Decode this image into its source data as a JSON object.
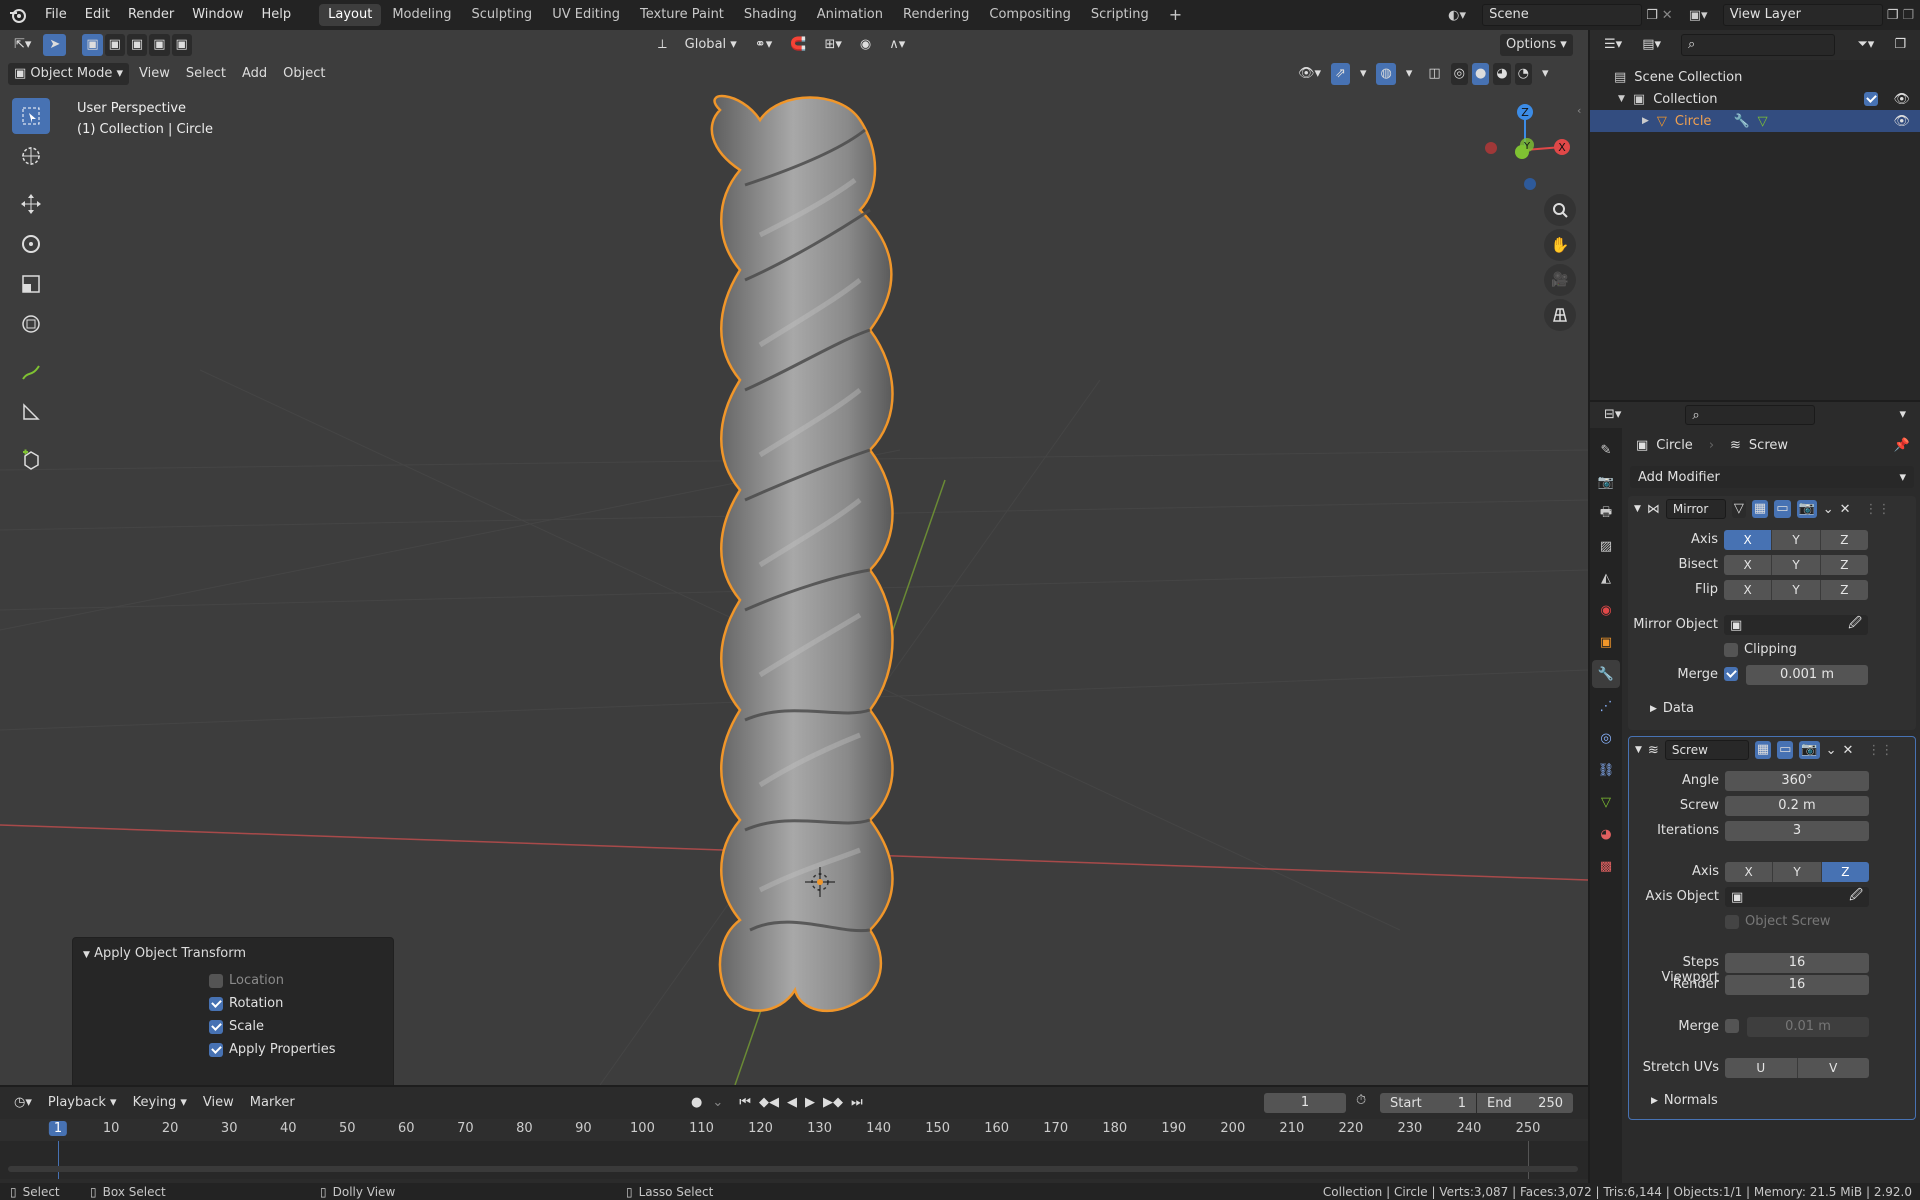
{
  "topbar": {
    "menus": [
      "File",
      "Edit",
      "Render",
      "Window",
      "Help"
    ],
    "workspaces": [
      "Layout",
      "Modeling",
      "Sculpting",
      "UV Editing",
      "Texture Paint",
      "Shading",
      "Animation",
      "Rendering",
      "Compositing",
      "Scripting"
    ],
    "active_workspace": "Layout",
    "scene": "Scene",
    "view_layer": "View Layer"
  },
  "viewport": {
    "transform_orientation": "Global",
    "options_label": "Options",
    "mode": "Object Mode",
    "header_menus": [
      "View",
      "Select",
      "Add",
      "Object"
    ],
    "overlay_line1": "User Perspective",
    "overlay_line2": "(1) Collection | Circle",
    "gizmo": {
      "x": "X",
      "y": "Y",
      "z": "Z"
    }
  },
  "redo_panel": {
    "title": "Apply Object Transform",
    "options": [
      {
        "label": "Location",
        "checked": false
      },
      {
        "label": "Rotation",
        "checked": true
      },
      {
        "label": "Scale",
        "checked": true
      },
      {
        "label": "Apply Properties",
        "checked": true
      }
    ]
  },
  "timeline": {
    "menus": [
      "Playback",
      "Keying",
      "View",
      "Marker"
    ],
    "current_frame": "1",
    "start_label": "Start",
    "start": "1",
    "end_label": "End",
    "end": "250",
    "ticks": [
      "1",
      "10",
      "20",
      "30",
      "40",
      "50",
      "60",
      "70",
      "80",
      "90",
      "100",
      "110",
      "120",
      "130",
      "140",
      "150",
      "160",
      "170",
      "180",
      "190",
      "200",
      "210",
      "220",
      "230",
      "240",
      "250"
    ]
  },
  "statusbar": {
    "select": "Select",
    "box_select": "Box Select",
    "dolly": "Dolly View",
    "lasso": "Lasso Select",
    "stats": "Collection | Circle | Verts:3,087 | Faces:3,072 | Tris:6,144 | Objects:1/1 | Memory: 21.5 MiB | 2.92.0"
  },
  "outliner": {
    "scene_collection": "Scene Collection",
    "collection": "Collection",
    "object": "Circle"
  },
  "properties": {
    "breadcrumb_object": "Circle",
    "breadcrumb_modifier": "Screw",
    "add_modifier": "Add Modifier",
    "mirror": {
      "name": "Mirror",
      "axis_label": "Axis",
      "bisect_label": "Bisect",
      "flip_label": "Flip",
      "xyz": [
        "X",
        "Y",
        "Z"
      ],
      "mirror_object_label": "Mirror Object",
      "clipping_label": "Clipping",
      "merge_label": "Merge",
      "merge_value": "0.001 m",
      "data_label": "Data"
    },
    "screw": {
      "name": "Screw",
      "angle_label": "Angle",
      "angle": "360°",
      "screw_label": "Screw",
      "screw": "0.2 m",
      "iterations_label": "Iterations",
      "iterations": "3",
      "axis_label": "Axis",
      "axis_object_label": "Axis Object",
      "object_screw_label": "Object Screw",
      "steps_viewport_label": "Steps Viewport",
      "steps_viewport": "16",
      "render_label": "Render",
      "render": "16",
      "merge_label": "Merge",
      "merge_value": "0.01 m",
      "stretch_uvs_label": "Stretch UVs",
      "u": "U",
      "v": "V",
      "normals_label": "Normals"
    }
  },
  "colors": {
    "accent": "#4772b3",
    "selection_outline": "#f0962a",
    "x_axis": "#e04848",
    "y_axis": "#7fc232",
    "z_axis": "#3c8ce6"
  }
}
